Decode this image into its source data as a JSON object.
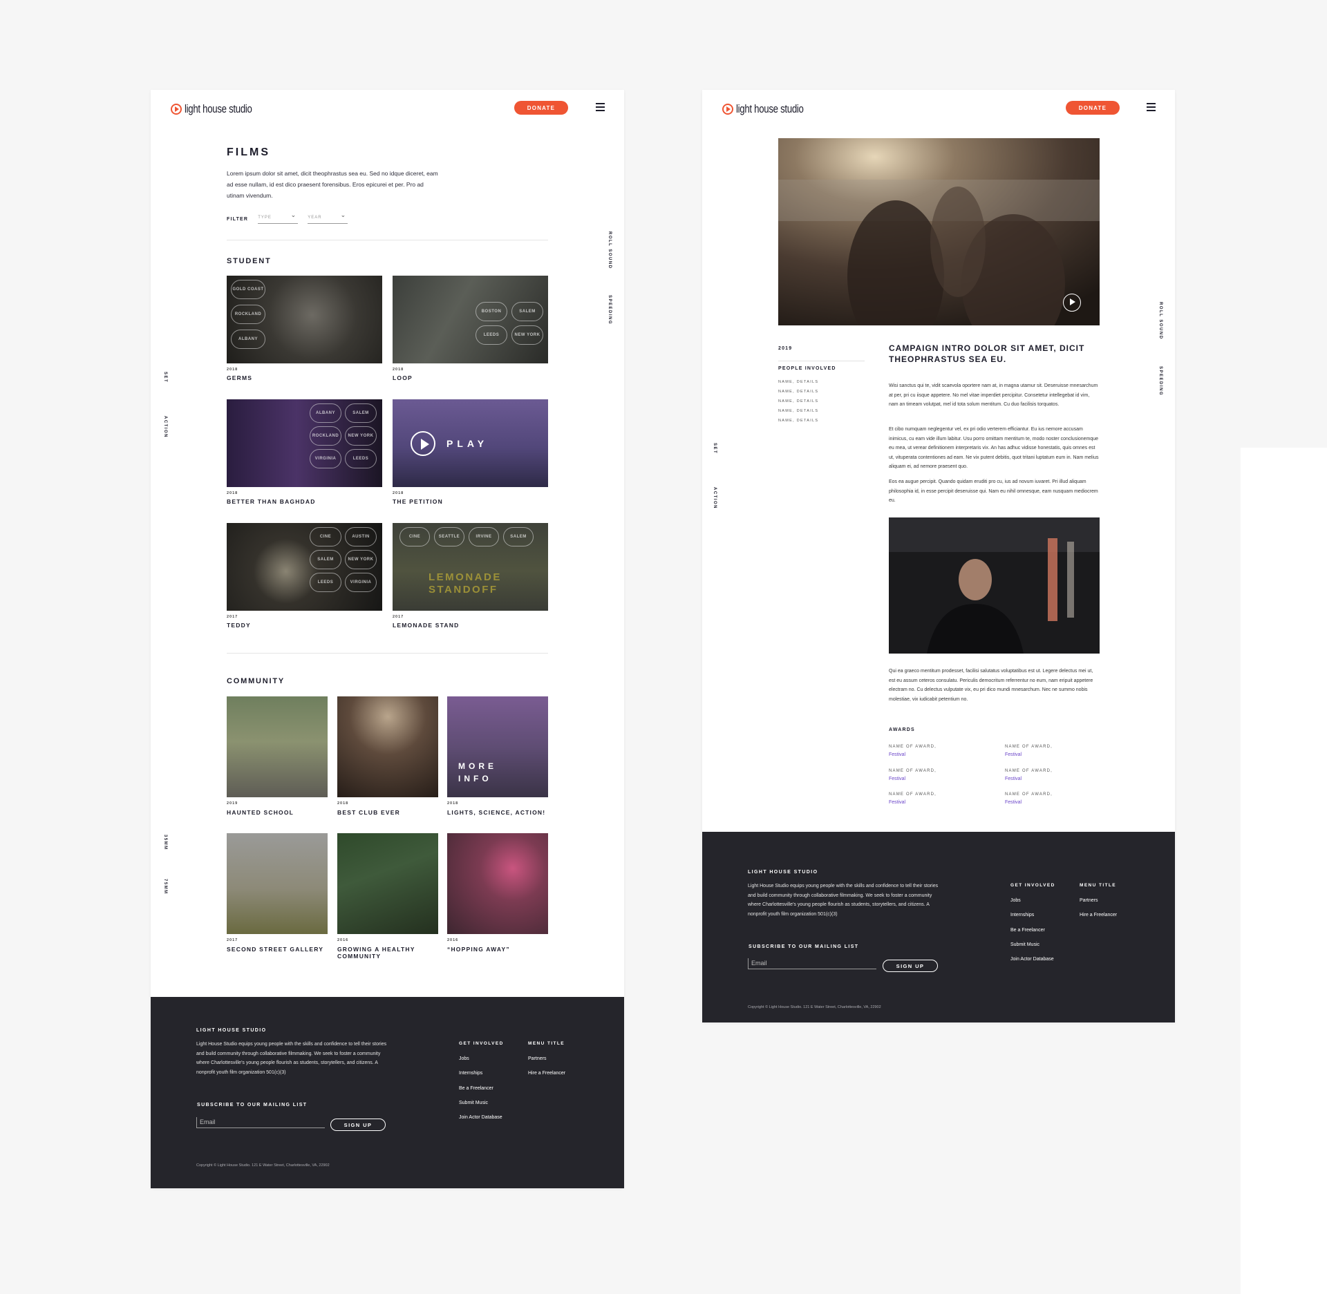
{
  "colors": {
    "accent": "#ef5533",
    "dark_footer": "#25252b",
    "award_link": "#6b46c9"
  },
  "brand": {
    "logo_text": "light house studio",
    "donate_label": "DONATE",
    "menu_icon": "hamburger-icon"
  },
  "side_labels": {
    "roll_sound": "ROLL SOUND",
    "speeding": "SPEEDING",
    "set": "SET",
    "action": "ACTION",
    "mm35": "35MM",
    "mm75": "75MM"
  },
  "films_page": {
    "title": "FILMS",
    "intro": "Lorem ipsum dolor sit amet, dicit theophrastus sea eu. Sed no idque diceret, eam ad esse nullam, id est dico praesent forensibus. Eros epicurei et per. Pro ad utinam vivendum.",
    "filter_label": "FILTER",
    "type_placeholder": "TYPE",
    "year_placeholder": "YEAR",
    "student_title": "STUDENT",
    "student": [
      {
        "year": "2018",
        "title": "GERMS"
      },
      {
        "year": "2018",
        "title": "LOOP"
      },
      {
        "year": "2018",
        "title": "BETTER THAN BAGHDAD"
      },
      {
        "year": "2018",
        "title": "THE PETITION"
      },
      {
        "year": "2017",
        "title": "TEDDY"
      },
      {
        "year": "2017",
        "title": "LEMONADE STAND"
      }
    ],
    "play_label": "PLAY",
    "lemonade_overlay": [
      "LEMONADE",
      "STANDOFF"
    ],
    "laurel_text": [
      "GOLD COAST",
      "ROCKLAND",
      "ALBANY",
      "BOSTON",
      "SALEM",
      "LEEDS",
      "NEW YORK",
      "VIRGINIA",
      "CINE",
      "SEATTLE",
      "IRVINE",
      "AUSTIN"
    ],
    "community_title": "COMMUNITY",
    "community": [
      {
        "year": "2019",
        "title": "HAUNTED SCHOOL"
      },
      {
        "year": "2018",
        "title": "BEST CLUB EVER"
      },
      {
        "year": "2018",
        "title": "LIGHTS, SCIENCE, ACTION!"
      },
      {
        "year": "2017",
        "title": "SECOND STREET GALLERY"
      },
      {
        "year": "2016",
        "title": "GROWING A HEALTHY COMMUNITY"
      },
      {
        "year": "2016",
        "title": "“HOPPING AWAY”"
      }
    ],
    "more_info": [
      "MORE",
      "INFO"
    ]
  },
  "detail_page": {
    "year": "2019",
    "people_title": "PEOPLE INVOLVED",
    "people": [
      "NAME, DETAILS",
      "NAME, DETAILS",
      "NAME, DETAILS",
      "NAME, DETAILS",
      "NAME, DETAILS"
    ],
    "headline": "CAMPAIGN INTRO DOLOR SIT AMET, DICIT THEOPHRASTUS SEA EU.",
    "paragraphs": [
      "Wisi sanctus qui te, vidit scaevola oportere nam at, in magna utamur sit. Deseruisse mnesarchum at per, pri cu iisque appetere. No mel vitae imperdiet percipitur. Consetetur intellegebat id vim, nam an timeam volutpat, mel id tota solum mentitum. Cu duo facilisis torquatos.",
      "Et cibo numquam neglegentur vel, ex pri odio verterem efficiantur. Eu ius nemore accusam inimicus, cu eam vide illum labitur. Usu porro omittam mentitum te, modo noster conclusionemque eu mea, ut verear definitionem interpretaris vix. An has adhuc vidisse honestatis, quis omnes est ut, vituperata contentiones ad eam. Ne vix putent debitis, quot tritani luptatum eum in. Nam melius aliquam ei, ad nemore praesent quo.",
      "Eos ea augue percipit. Quando quidam eruditi pro cu, ius ad novum iuvaret. Pri illud aliquam philosophia id, in esse percipit deseruisse qui. Nam eu nihil omnesque, eam nusquam mediocrem eu.",
      "Qui ea graeco mentitum prodesset, facilisi salutatus voluptatibus est ut. Legere delectus mei ut, est eu assum ceteros consulatu. Periculis democritum referrentur no eum, nam eripuit appetere electram no. Cu delectus vulputate vix, eu pri dico mundi mnesarchum. Nec ne summo nobis molestiae, vix iudicabit petentium no."
    ],
    "awards_title": "AWARDS",
    "awards": [
      {
        "name": "NAME OF AWARD,",
        "festival": "Festival"
      },
      {
        "name": "NAME OF AWARD,",
        "festival": "Festival"
      },
      {
        "name": "NAME OF AWARD,",
        "festival": "Festival"
      },
      {
        "name": "NAME OF AWARD,",
        "festival": "Festival"
      },
      {
        "name": "NAME OF AWARD,",
        "festival": "Festival"
      },
      {
        "name": "NAME OF AWARD,",
        "festival": "Festival"
      }
    ]
  },
  "footer": {
    "title": "LIGHT HOUSE STUDIO",
    "about": "Light House Studio equips young people with the skills and confidence to tell their stories and build community through collaborative filmmaking. We seek to foster a community where Charlottesville’s young people flourish as students, storytellers, and citizens. A nonprofit youth film organization 501(c)(3)",
    "subscribe_title": "SUBSCRIBE TO OUR MAILING LIST",
    "email_placeholder": "Email",
    "signup_label": "SIGN UP",
    "col1_title": "GET INVOLVED",
    "col1_links": [
      "Jobs",
      "Internships",
      "Be a Freelancer",
      "Submit Music",
      "Join Actor Database"
    ],
    "col2_title": "MENU TITLE",
    "col2_links": [
      "Partners",
      "Hire a Freelancer"
    ],
    "copyright": "Copyright © Light House Studio. 121 E Water Street, Charlottesville, VA, 22902"
  }
}
